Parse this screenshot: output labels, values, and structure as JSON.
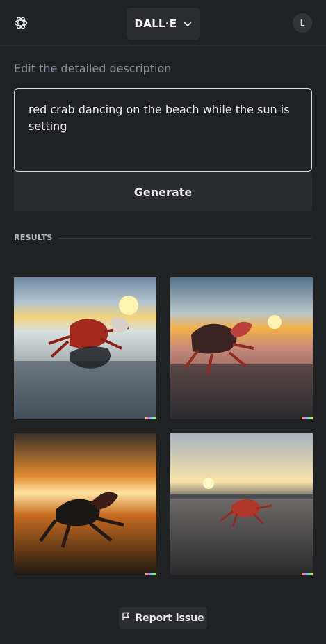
{
  "header": {
    "model_label": "DALL·E",
    "avatar_initial": "L"
  },
  "editor": {
    "label": "Edit the detailed description",
    "prompt": "red crab dancing on the beach while the sun is setting",
    "generate_label": "Generate"
  },
  "results": {
    "section_label": "RESULTS",
    "images": [
      {
        "alt": "red crab on beach with reflection at sunset"
      },
      {
        "alt": "red crab on wet sand with sunset"
      },
      {
        "alt": "silhouette crab with orange sunset sky"
      },
      {
        "alt": "red crab walking on beach at sunset"
      }
    ]
  },
  "footer": {
    "report_label": "Report issue"
  }
}
